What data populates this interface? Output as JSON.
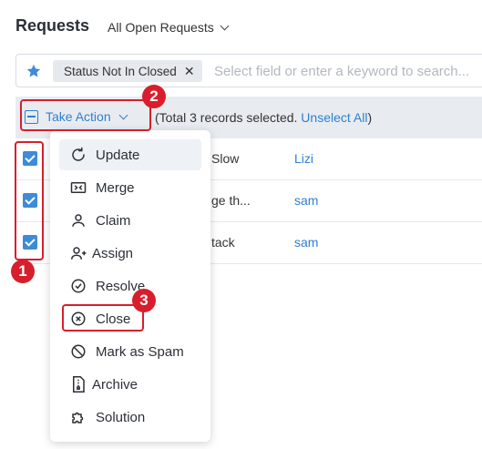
{
  "header": {
    "title": "Requests",
    "view_label": "All Open Requests"
  },
  "filter": {
    "chip_label": "Status Not In Closed",
    "search_placeholder": "Select field or enter a keyword to search..."
  },
  "action_bar": {
    "take_action_label": "Take Action",
    "selection_prefix": "(Total 3 records selected. ",
    "unselect_label": "Unselect All",
    "selection_suffix": ")"
  },
  "rows": [
    {
      "subject": "Slow",
      "requester": "Lizi",
      "checked": true
    },
    {
      "subject": "ge th...",
      "requester": "sam",
      "checked": true
    },
    {
      "subject": "tack",
      "requester": "sam",
      "checked": true
    }
  ],
  "menu": {
    "items": [
      {
        "label": "Update",
        "icon": "refresh-icon"
      },
      {
        "label": "Merge",
        "icon": "merge-icon"
      },
      {
        "label": "Claim",
        "icon": "user-icon"
      },
      {
        "label": "Assign",
        "icon": "user-plus-icon"
      },
      {
        "label": "Resolve",
        "icon": "check-circle-icon"
      },
      {
        "label": "Close",
        "icon": "x-circle-icon"
      },
      {
        "label": "Mark as Spam",
        "icon": "ban-icon"
      },
      {
        "label": "Archive",
        "icon": "archive-file-icon"
      },
      {
        "label": "Solution",
        "icon": "puzzle-icon"
      }
    ]
  },
  "annotations": {
    "badge_1": "1",
    "badge_2": "2",
    "badge_3": "3",
    "color": "#d81e2c"
  },
  "colors": {
    "accent": "#2f7fd0",
    "checkbox": "#3d8bd9",
    "action_bar_bg": "#e8ecf1"
  }
}
